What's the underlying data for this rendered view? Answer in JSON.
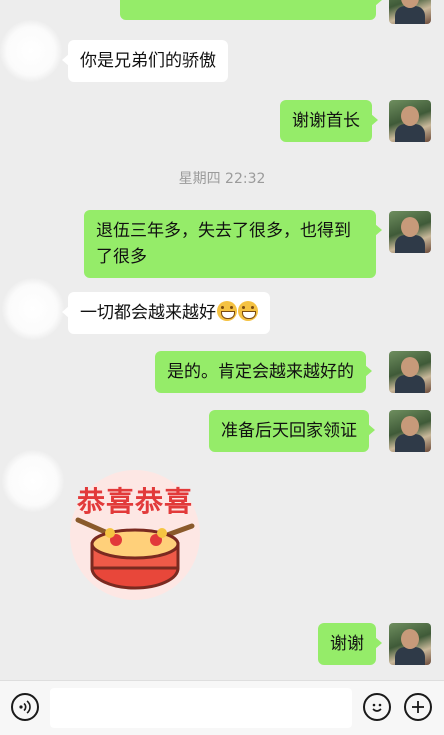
{
  "messages": {
    "m1": "你是兄弟们的骄傲",
    "m2": "谢谢首长",
    "m3": "退伍三年多，失去了很多，也得到了很多",
    "m4": "一切都会越来越好",
    "m5": "是的。肯定会越来越好的",
    "m6": "准备后天回家领证",
    "m8": "谢谢"
  },
  "timestamp": "星期四 22:32",
  "sticker": {
    "text": "恭喜恭喜"
  },
  "icons": {
    "voice": "voice-icon",
    "emoji": "emoji-icon",
    "plus": "plus-icon",
    "grin": "grin-emoji"
  },
  "colors": {
    "my_bubble": "#95ec69",
    "other_bubble": "#ffffff",
    "background": "#ededed"
  }
}
